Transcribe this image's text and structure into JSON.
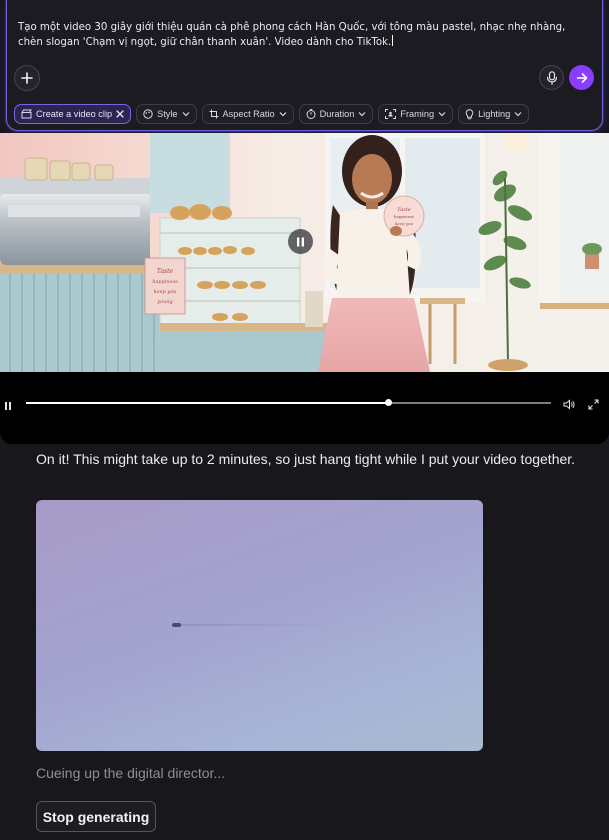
{
  "composer": {
    "prompt_text": "Tạo một video 30 giây giới thiệu quán cà phê phong cách Hàn Quốc, với tông màu pastel, nhạc nhẹ nhàng, chèn slogan 'Chạm vị ngọt, giữ chân thanh xuân'. Video dành cho TikTok.",
    "add_icon": "plus-icon",
    "mic_icon": "microphone-icon",
    "send_icon": "arrow-right-icon",
    "accent": "#8b3dff"
  },
  "chips": [
    {
      "label": "Create a video clip",
      "icon": "video-clip-icon",
      "active": true
    },
    {
      "label": "Style",
      "icon": "palette-icon"
    },
    {
      "label": "Aspect Ratio",
      "icon": "crop-icon"
    },
    {
      "label": "Duration",
      "icon": "timer-icon"
    },
    {
      "label": "Framing",
      "icon": "framing-icon"
    },
    {
      "label": "Lighting",
      "icon": "bulb-icon"
    }
  ],
  "video": {
    "sign_text": "Taste happiness keep you young",
    "progress": 0.69
  },
  "chat": {
    "assistant_message": "On it! This might take up to 2 minutes, so just hang tight while I put your video together.",
    "status_text": "Cueing up the digital director...",
    "stop_button": "Stop generating"
  }
}
